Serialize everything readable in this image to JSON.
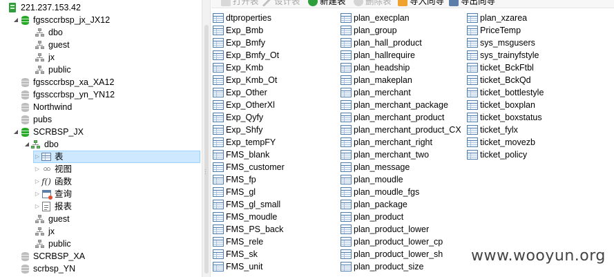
{
  "toolbar": {
    "open_label": "打开表",
    "design_label": "设计表",
    "new_label": "新建表",
    "delete_label": "删除表",
    "import_label": "导入向导",
    "export_label": "导出向导"
  },
  "tree": {
    "connection": "221.237.153.42",
    "db1": {
      "name": "fgssccrbsp_jx_JX12",
      "schemas": [
        "dbo",
        "guest",
        "jx",
        "public"
      ]
    },
    "db2": "fgssccrbsp_xa_XA12",
    "db3": "fgssccrbsp_yn_YN12",
    "db4": "Northwind",
    "db5": "pubs",
    "db6": {
      "name": "SCRBSP_JX",
      "schema_open": "dbo",
      "categories": {
        "tables": "表",
        "views": "视图",
        "functions": "函数",
        "queries": "查询",
        "reports": "报表"
      },
      "schemas_after": [
        "guest",
        "jx",
        "public"
      ]
    },
    "db7": "SCRBSP_XA",
    "db8": "scrbsp_YN"
  },
  "tables": {
    "col1": [
      "dtproperties",
      "Exp_Bmb",
      "Exp_Bmfy",
      "Exp_Bmfy_Ot",
      "Exp_Kmb",
      "Exp_Kmb_Ot",
      "Exp_Other",
      "Exp_OtherXl",
      "Exp_Qyfy",
      "Exp_Shfy",
      "Exp_tempFY",
      "FMS_blank",
      "FMS_customer",
      "FMS_fp",
      "FMS_gl",
      "FMS_gl_small",
      "FMS_moudle",
      "FMS_PS_back",
      "FMS_rele",
      "FMS_sk",
      "FMS_unit"
    ],
    "col2": [
      "plan_execplan",
      "plan_group",
      "plan_hall_product",
      "plan_hallrequire",
      "plan_headship",
      "plan_makeplan",
      "plan_merchant",
      "plan_merchant_package",
      "plan_merchant_product",
      "plan_merchant_product_CX",
      "plan_merchant_right",
      "plan_merchant_two",
      "plan_message",
      "plan_moudle",
      "plan_moudle_fgs",
      "plan_package",
      "plan_product",
      "plan_product_lower",
      "plan_product_lower_cp",
      "plan_product_lower_sh",
      "plan_product_size"
    ],
    "col3": [
      "plan_xzarea",
      "PriceTemp",
      "sys_msgusers",
      "sys_trainyfstyle",
      "ticket_BckFtbl",
      "ticket_BckQd",
      "ticket_bottlestyle",
      "ticket_boxplan",
      "ticket_boxstatus",
      "ticket_fylx",
      "ticket_movezb",
      "ticket_policy"
    ]
  },
  "watermark": "www.wooyun.org"
}
